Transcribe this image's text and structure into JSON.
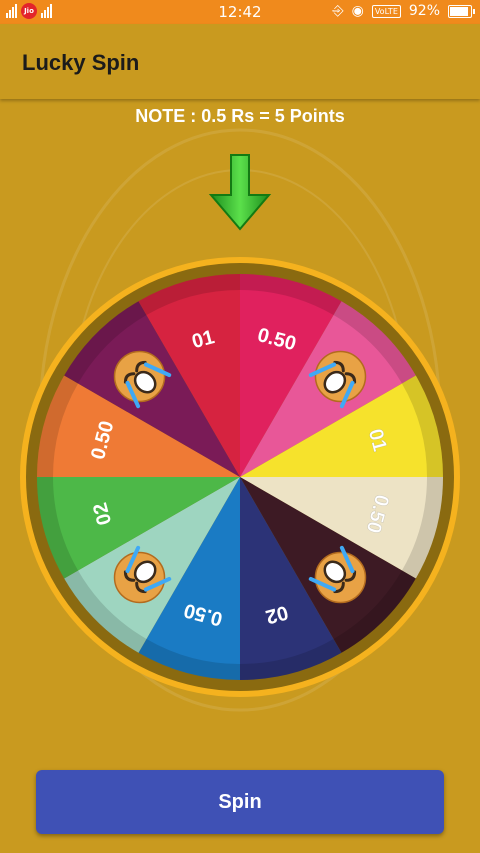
{
  "status_bar": {
    "carrier": "Jio",
    "time": "12:42",
    "network": "VoLTE",
    "battery": "92%"
  },
  "app_bar": {
    "title": "Lucky Spin"
  },
  "note": "NOTE : 0.5 Rs = 5 Points",
  "wheel": {
    "segments": [
      {
        "label": "0.50",
        "color": "#E0215E",
        "type": "text"
      },
      {
        "label": "",
        "color": "#E85798",
        "type": "emoji"
      },
      {
        "label": "01",
        "color": "#F6E22C",
        "type": "text"
      },
      {
        "label": "0.50",
        "color": "#EDE3C5",
        "type": "text"
      },
      {
        "label": "",
        "color": "#3D1A24",
        "type": "emoji"
      },
      {
        "label": "02",
        "color": "#2C3377",
        "type": "text"
      },
      {
        "label": "0.50",
        "color": "#1A7BC4",
        "type": "text"
      },
      {
        "label": "",
        "color": "#9ED5C0",
        "type": "emoji"
      },
      {
        "label": "02",
        "color": "#4DB848",
        "type": "text"
      },
      {
        "label": "0.50",
        "color": "#EF7A35",
        "type": "text"
      },
      {
        "label": "",
        "color": "#7A1B57",
        "type": "emoji"
      },
      {
        "label": "01",
        "color": "#D62340",
        "type": "text"
      }
    ],
    "rim_color": "#F5B21E",
    "emoji_icon": "crying-face-emoji"
  },
  "spin_button": {
    "label": "Spin"
  }
}
